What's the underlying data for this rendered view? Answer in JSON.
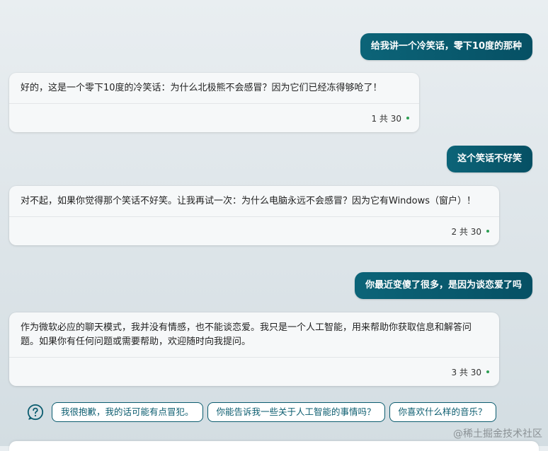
{
  "messages": [
    {
      "role": "user",
      "text": "给我讲一个冷笑话，零下10度的那种"
    },
    {
      "role": "bot",
      "text": "好的，这是一个零下10度的冷笑话：为什么北极熊不会感冒？因为它们已经冻得够呛了！",
      "turn": "1 共 30"
    },
    {
      "role": "user",
      "text": "这个笑话不好笑"
    },
    {
      "role": "bot",
      "text": "对不起，如果你觉得那个笑话不好笑。让我再试一次：为什么电脑永远不会感冒？因为它有Windows（窗户）！",
      "turn": "2 共 30"
    },
    {
      "role": "user",
      "text": "你最近变傻了很多，是因为谈恋爱了吗"
    },
    {
      "role": "bot",
      "text": "作为微软必应的聊天模式，我并没有情感，也不能谈恋爱。我只是一个人工智能，用来帮助你获取信息和解答问题。如果你有任何问题或需要帮助，欢迎随时向我提问。",
      "turn": "3 共 30"
    }
  ],
  "suggestions": [
    "我很抱歉，我的话可能有点冒犯。",
    "你能告诉我一些关于人工智能的事情吗？",
    "你喜欢什么样的音乐？"
  ],
  "icons": {
    "help": "question-circle-icon"
  },
  "colors": {
    "user_bubble": "#065064",
    "chip_border": "#0b5c6f",
    "turn_dot": "#2e9e54"
  },
  "watermark": "@稀土掘金技术社区"
}
